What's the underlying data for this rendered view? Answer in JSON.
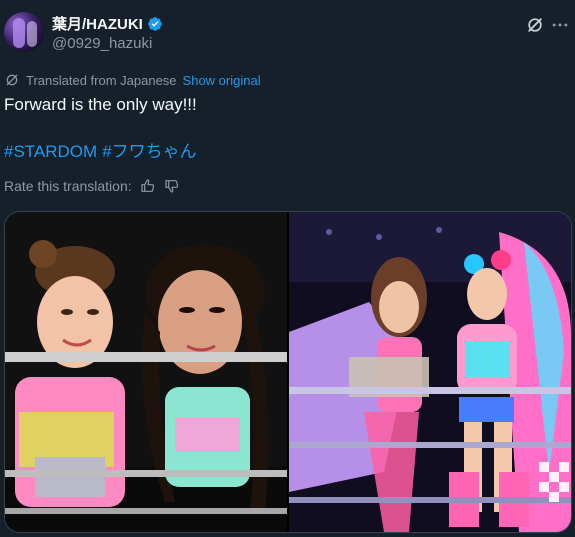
{
  "user": {
    "display_name": "葉月/HAZUKI",
    "handle": "@0929_hazuki"
  },
  "translation": {
    "notice": "Translated from Japanese",
    "show_original": "Show original",
    "rate_label": "Rate this translation:"
  },
  "tweet": {
    "text": "Forward is the only way!!!",
    "hashtags": [
      "#STARDOM",
      "#フワちゃん"
    ]
  },
  "icons": {
    "verified": "verified-badge-icon",
    "grok": "grok-icon",
    "more": "more-icon",
    "translate": "translate-icon",
    "thumbs_up": "thumbs-up-icon",
    "thumbs_down": "thumbs-down-icon"
  },
  "colors": {
    "background": "#15202b",
    "accent": "#1d9bf0",
    "secondary_text": "#8b98a5"
  }
}
